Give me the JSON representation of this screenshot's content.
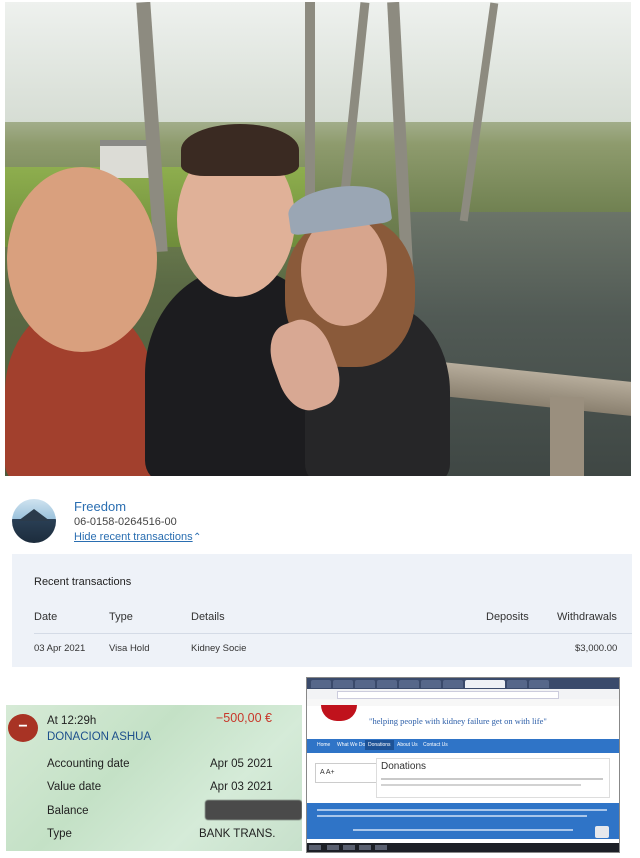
{
  "account": {
    "name": "Freedom",
    "number": "06-0158-0264516-00",
    "hide_link": "Hide recent transactions"
  },
  "transactions": {
    "title": "Recent transactions",
    "headers": {
      "date": "Date",
      "type": "Type",
      "details": "Details",
      "deposits": "Deposits",
      "withdrawals": "Withdrawals"
    },
    "rows": [
      {
        "date": "03 Apr 2021",
        "type": "Visa Hold",
        "details": "Kidney Socie",
        "deposits": "",
        "withdrawals": "$3,000.00"
      }
    ]
  },
  "receipt": {
    "time": "At 12:29h",
    "amount": "−500,00 €",
    "payee": "DONACION ASHUA",
    "accounting_date_label": "Accounting date",
    "accounting_date": "Apr 05 2021",
    "value_date_label": "Value date",
    "value_date": "Apr 03 2021",
    "balance_label": "Balance",
    "type_label": "Type",
    "type_value": "BANK TRANS.",
    "minus_symbol": "−"
  },
  "website": {
    "tagline": "\"helping people with kidney failure get on with life\"",
    "nav": [
      "Home",
      "What We Do",
      "Donations",
      "About Us",
      "Contact Us"
    ],
    "font_sizer": "A A+",
    "donations_title": "Donations"
  },
  "colors": {
    "bank_link": "#2a6eb1",
    "amount_red": "#c8372a",
    "site_blue": "#2f74c7",
    "kidney_red": "#c0121c"
  }
}
